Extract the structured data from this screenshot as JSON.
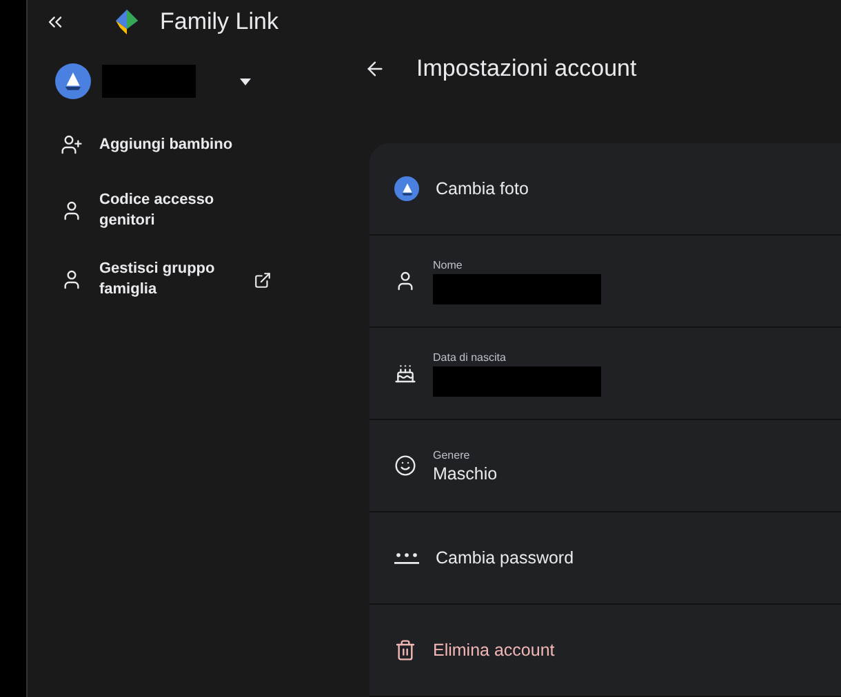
{
  "app": {
    "title": "Family Link"
  },
  "account": {
    "redacted": true
  },
  "sidebar": {
    "items": [
      {
        "label": "Aggiungi bambino",
        "external": false
      },
      {
        "label": "Codice accesso genitori",
        "external": false
      },
      {
        "label": "Gestisci gruppo famiglia",
        "external": true
      }
    ]
  },
  "page": {
    "title": "Impostazioni account"
  },
  "rows": [
    {
      "kind": "photo",
      "text": "Cambia foto"
    },
    {
      "kind": "field",
      "label": "Nome",
      "redacted": true
    },
    {
      "kind": "field",
      "label": "Data di nascita",
      "redacted": true
    },
    {
      "kind": "field",
      "label": "Genere",
      "value": "Maschio",
      "redacted": false
    },
    {
      "kind": "action",
      "text": "Cambia password"
    },
    {
      "kind": "danger",
      "text": "Elimina account"
    }
  ]
}
